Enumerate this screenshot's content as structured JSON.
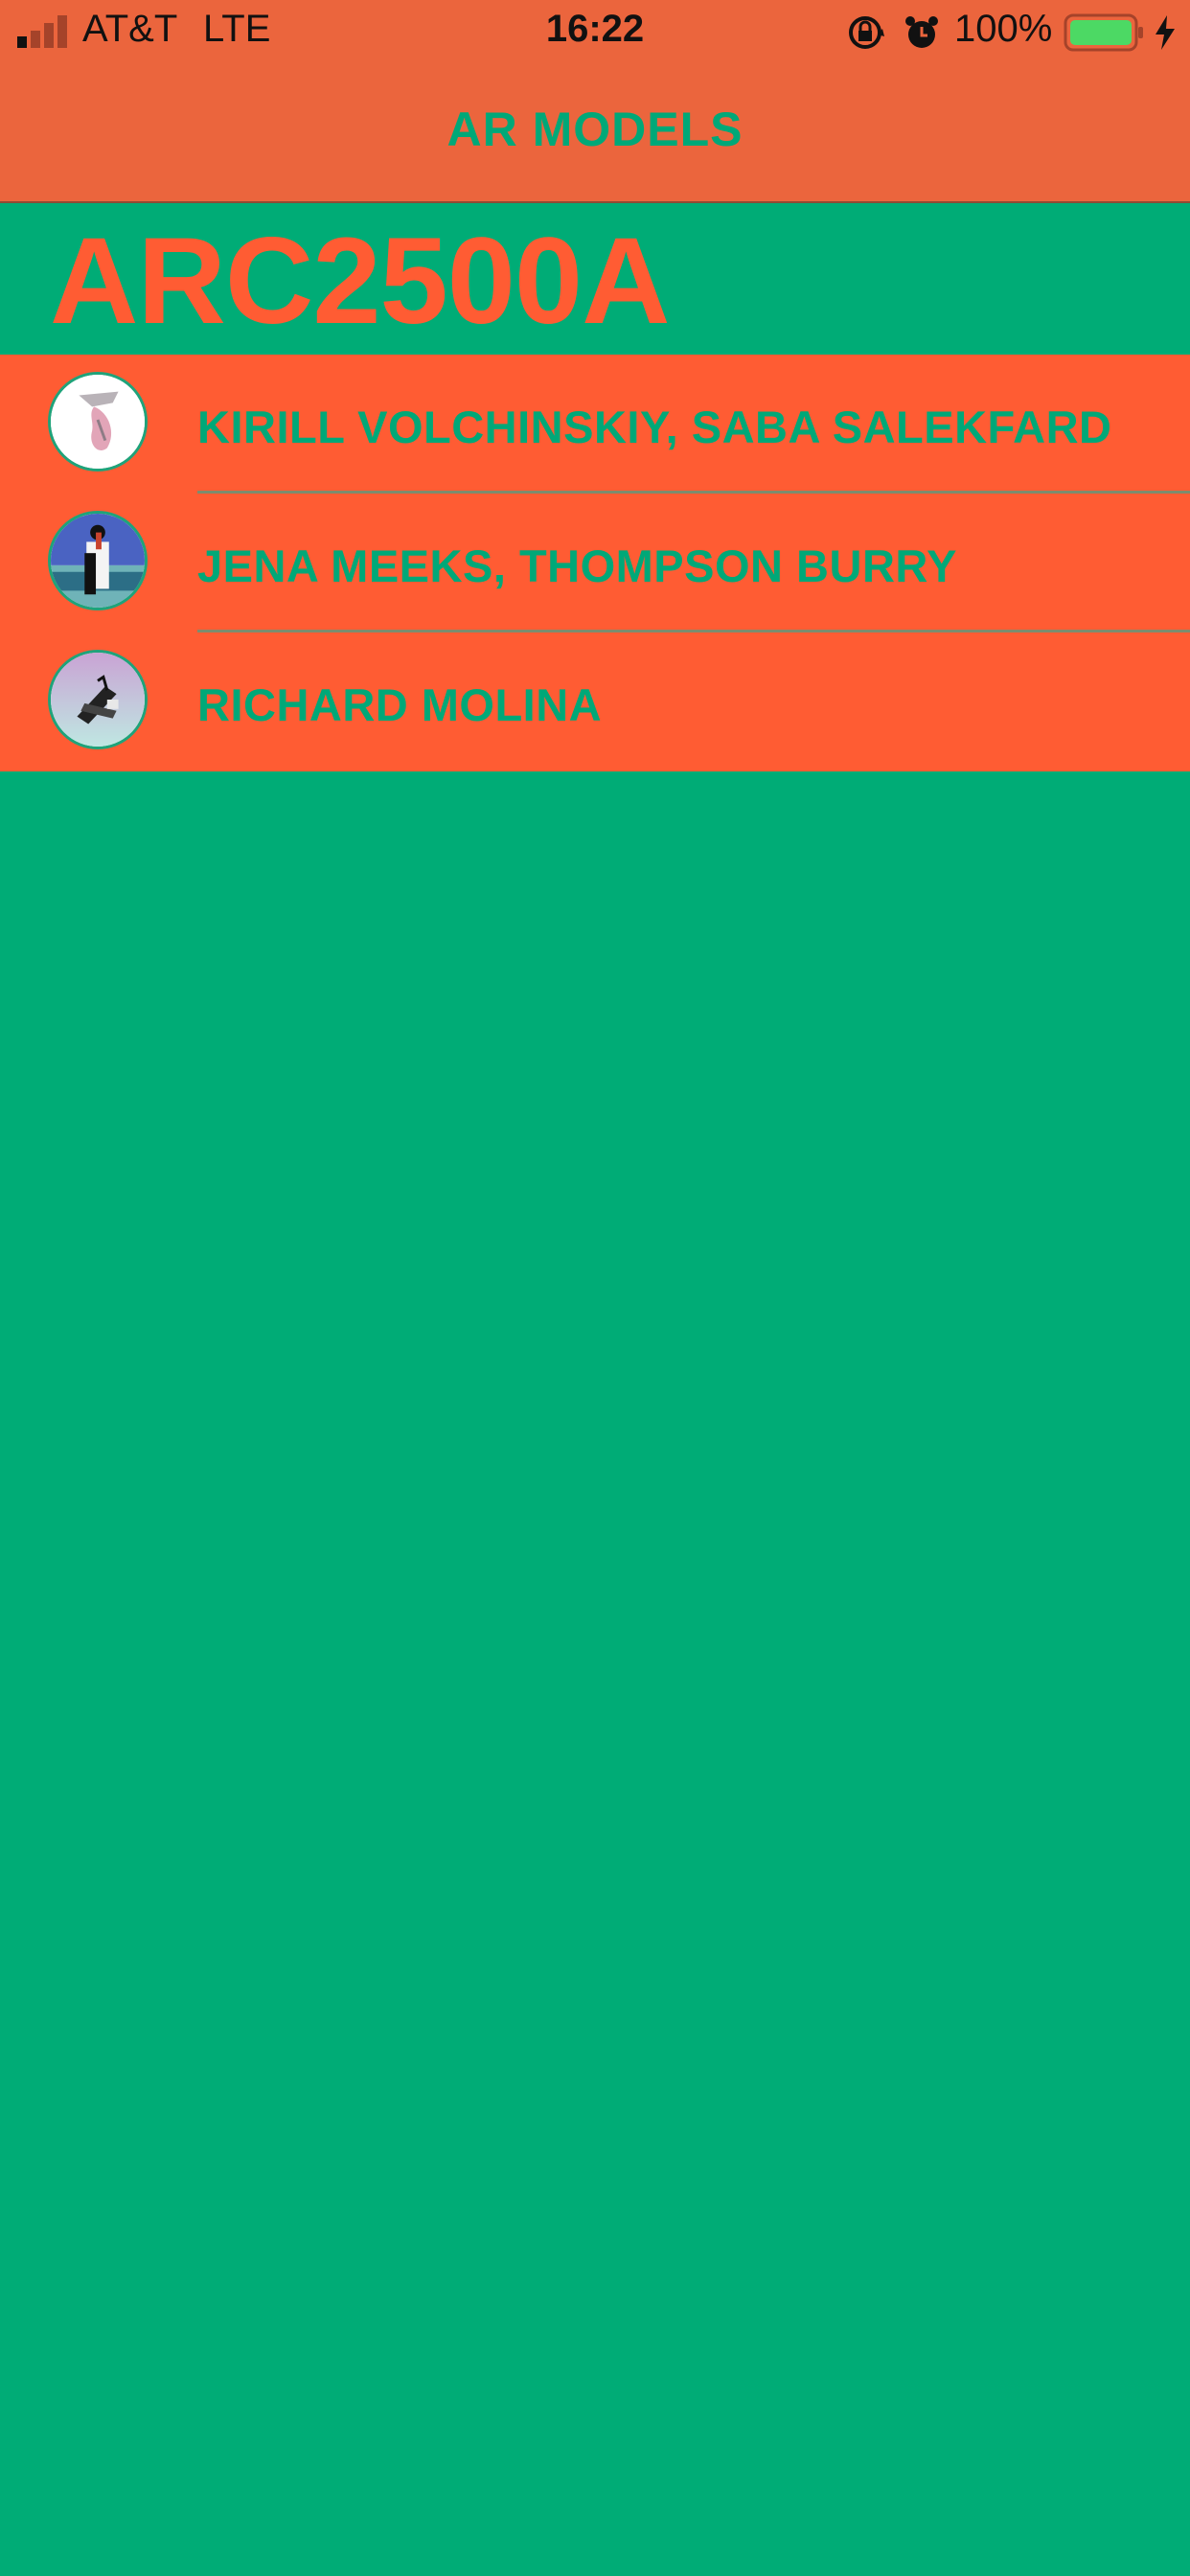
{
  "status_bar": {
    "carrier": "AT&T",
    "network": "LTE",
    "time": "16:22",
    "battery": "100%",
    "icons": [
      "signal-icon",
      "orientation-lock-icon",
      "alarm-icon",
      "battery-icon",
      "charging-bolt-icon"
    ]
  },
  "nav": {
    "title": "AR MODELS"
  },
  "header": {
    "title": "ARC2500A"
  },
  "list": {
    "items": [
      {
        "label": "KIRILL VOLCHINSKIY, SABA SALEKFARD"
      },
      {
        "label": "JENA MEEKS, THOMPSON BURRY"
      },
      {
        "label": "RICHARD MOLINA"
      }
    ]
  },
  "colors": {
    "nav_background": "#EB653D",
    "page_background": "#00AC76",
    "list_background": "#FF5C33",
    "accent_green_text": "#00A878",
    "accent_orange_text": "#FF5C33"
  }
}
